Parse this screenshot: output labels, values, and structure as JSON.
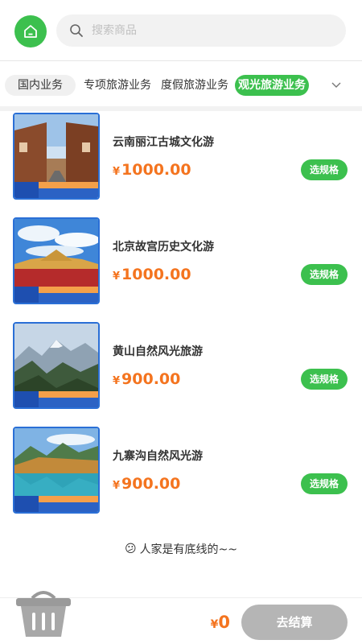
{
  "search": {
    "placeholder": "搜索商品"
  },
  "tabs": [
    {
      "label": "国内业务",
      "active": false
    },
    {
      "label": "专项旅游业务",
      "active": false
    },
    {
      "label": "度假旅游业务",
      "active": false
    },
    {
      "label": "观光旅游业务",
      "active": true
    }
  ],
  "products": [
    {
      "name": "云南丽江古城文化游",
      "currency": "¥",
      "price": "1000.00",
      "button": "选规格",
      "thumb": "old-town-street"
    },
    {
      "name": "北京故宫历史文化游",
      "currency": "¥",
      "price": "1000.00",
      "button": "选规格",
      "thumb": "palace-roof"
    },
    {
      "name": "黄山自然风光旅游",
      "currency": "¥",
      "price": "900.00",
      "button": "选规格",
      "thumb": "mountain-valley"
    },
    {
      "name": "九寨沟自然风光游",
      "currency": "¥",
      "price": "900.00",
      "button": "选规格",
      "thumb": "lake-reflection"
    }
  ],
  "thumb_badge": {
    "left_line1": "专业",
    "left_line2": "看图",
    "right_top": "品质旅游",
    "right_bottom": "品质保障服务至上"
  },
  "end_note": {
    "emoji": "😕",
    "text": "人家是有底线的~~"
  },
  "cart": {
    "currency": "¥",
    "total": "0",
    "checkout_label": "去结算"
  },
  "colors": {
    "accent": "#3cc04e",
    "price": "#f4741f",
    "checkout_disabled": "#b5b5b5"
  }
}
